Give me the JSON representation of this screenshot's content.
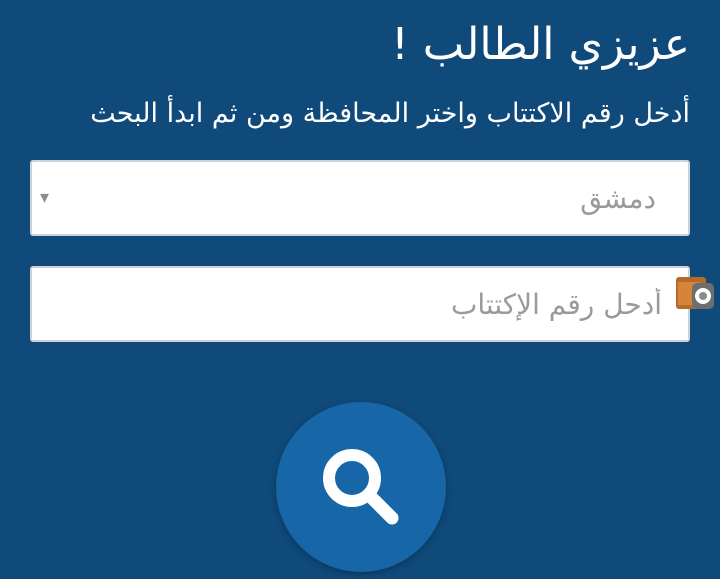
{
  "header": {
    "title": "عزيزي الطالب !",
    "instructions": "أدخل رقم الاكتتاب واختر المحافظة ومن ثم ابدأ البحث"
  },
  "form": {
    "governorate": {
      "selected": "دمشق",
      "arrow": "▾"
    },
    "subscription_number": {
      "placeholder": "أدحل رقم الإكتتاب",
      "value": ""
    }
  },
  "icons": {
    "autofill": "autofill-helper-icon",
    "search": "search-icon"
  },
  "colors": {
    "background": "#0f4a7b",
    "button": "#1766a7",
    "input_background": "#ffffff",
    "placeholder": "#9a9a9a",
    "text_light": "#ffffff"
  }
}
